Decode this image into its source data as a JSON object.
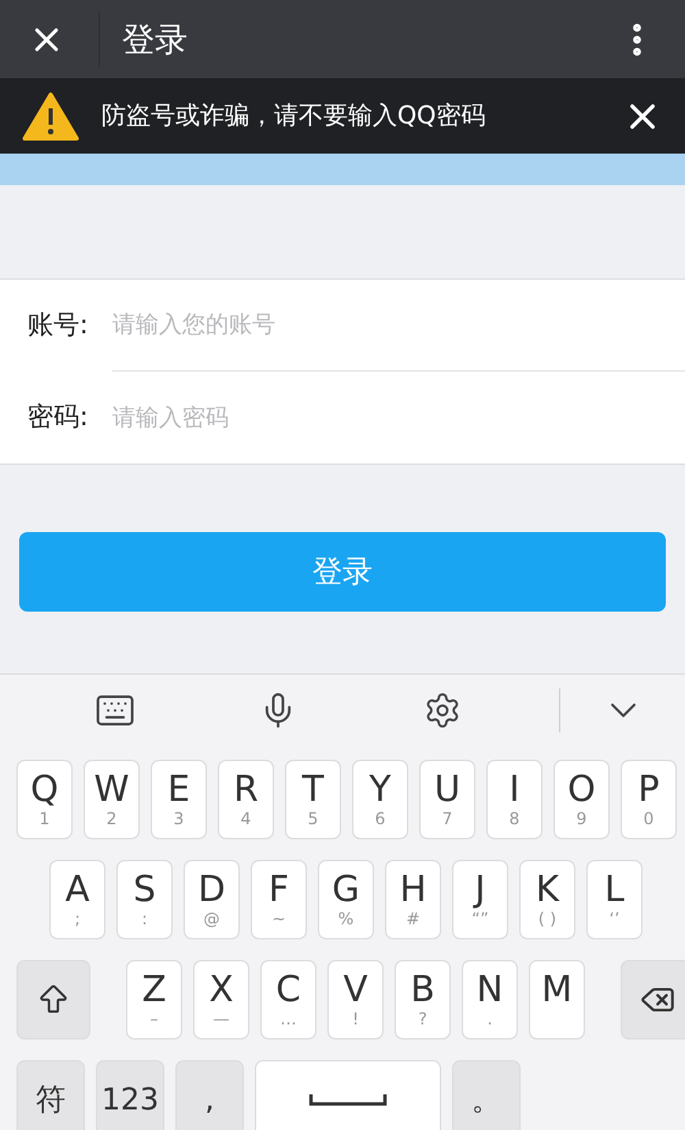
{
  "top_bar": {
    "title": "登录"
  },
  "warning_banner": {
    "text": "防盗号或诈骗，请不要输入QQ密码"
  },
  "form": {
    "fields": [
      {
        "label": "账号:",
        "placeholder": "请输入您的账号"
      },
      {
        "label": "密码:",
        "placeholder": "请输入密码"
      }
    ]
  },
  "login_button": "登录",
  "keyboard": {
    "rows": [
      {
        "keys": [
          {
            "kind": "letter",
            "label": "Q",
            "sub": "1"
          },
          {
            "kind": "letter",
            "label": "W",
            "sub": "2"
          },
          {
            "kind": "letter",
            "label": "E",
            "sub": "3"
          },
          {
            "kind": "letter",
            "label": "R",
            "sub": "4"
          },
          {
            "kind": "letter",
            "label": "T",
            "sub": "5"
          },
          {
            "kind": "letter",
            "label": "Y",
            "sub": "6"
          },
          {
            "kind": "letter",
            "label": "U",
            "sub": "7"
          },
          {
            "kind": "letter",
            "label": "I",
            "sub": "8"
          },
          {
            "kind": "letter",
            "label": "O",
            "sub": "9"
          },
          {
            "kind": "letter",
            "label": "P",
            "sub": "0"
          }
        ]
      },
      {
        "keys": [
          {
            "kind": "letter",
            "label": "A",
            "sub": ";"
          },
          {
            "kind": "letter",
            "label": "S",
            "sub": ":"
          },
          {
            "kind": "letter",
            "label": "D",
            "sub": "@"
          },
          {
            "kind": "letter",
            "label": "F",
            "sub": "~"
          },
          {
            "kind": "letter",
            "label": "G",
            "sub": "%"
          },
          {
            "kind": "letter",
            "label": "H",
            "sub": "#"
          },
          {
            "kind": "letter",
            "label": "J",
            "sub": "“”"
          },
          {
            "kind": "letter",
            "label": "K",
            "sub": "( )"
          },
          {
            "kind": "letter",
            "label": "L",
            "sub": "‘’"
          }
        ]
      },
      {
        "keys": [
          {
            "kind": "shift"
          },
          {
            "kind": "letter",
            "label": "Z",
            "sub": "–"
          },
          {
            "kind": "letter",
            "label": "X",
            "sub": "—"
          },
          {
            "kind": "letter",
            "label": "C",
            "sub": "…"
          },
          {
            "kind": "letter",
            "label": "V",
            "sub": "!"
          },
          {
            "kind": "letter",
            "label": "B",
            "sub": "?"
          },
          {
            "kind": "letter",
            "label": "N",
            "sub": "."
          },
          {
            "kind": "letter",
            "label": "M"
          },
          {
            "kind": "backspace"
          }
        ]
      },
      {
        "keys": [
          {
            "kind": "function",
            "label": "符"
          },
          {
            "kind": "function",
            "label": "123"
          },
          {
            "kind": "function",
            "label": ","
          },
          {
            "kind": "space"
          },
          {
            "kind": "function",
            "label": "。"
          }
        ]
      }
    ]
  }
}
